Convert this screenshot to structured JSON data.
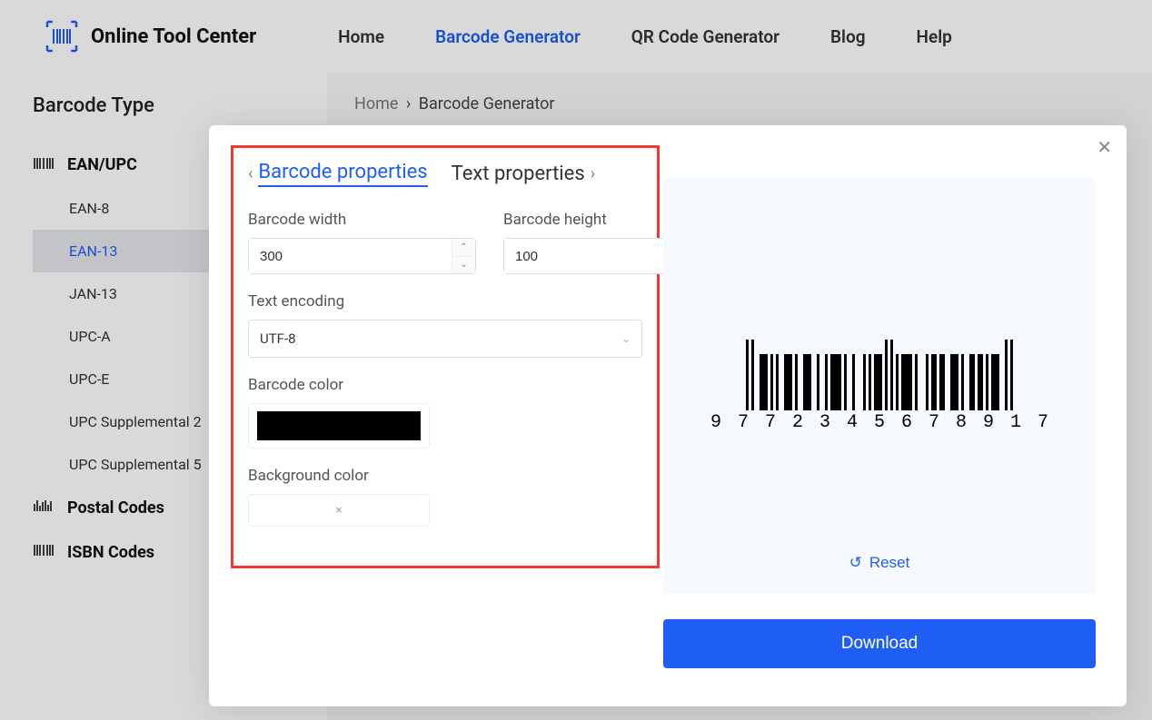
{
  "header": {
    "brand": "Online Tool Center",
    "nav": {
      "home": "Home",
      "barcode": "Barcode Generator",
      "qr": "QR Code Generator",
      "blog": "Blog",
      "help": "Help"
    }
  },
  "sidebar": {
    "title": "Barcode Type",
    "groups": {
      "eanupc": "EAN/UPC",
      "postal": "Postal Codes",
      "isbn": "ISBN Codes"
    },
    "items": {
      "ean8": "EAN-8",
      "ean13": "EAN-13",
      "jan13": "JAN-13",
      "upca": "UPC-A",
      "upce": "UPC-E",
      "upcsup2": "UPC Supplemental 2",
      "upcsup5": "UPC Supplemental 5"
    }
  },
  "breadcrumb": {
    "first": "Home",
    "second": "Barcode Generator"
  },
  "modal": {
    "tabs": {
      "barcode_props": "Barcode properties",
      "text_props": "Text properties"
    },
    "labels": {
      "width": "Barcode width",
      "height": "Barcode height",
      "encoding": "Text encoding",
      "color": "Barcode color",
      "bgcolor": "Background color"
    },
    "values": {
      "width": "300",
      "height": "100",
      "encoding": "UTF-8",
      "bgcolor_clear": "×",
      "barcode_color": "#000000",
      "background_color": "#FFFFFF"
    },
    "reset": "Reset",
    "download": "Download"
  },
  "barcode": {
    "digits": [
      "9",
      "7",
      "7",
      "2",
      "3",
      "4",
      "5",
      "6",
      "7",
      "8",
      "9",
      "1",
      "7"
    ]
  }
}
